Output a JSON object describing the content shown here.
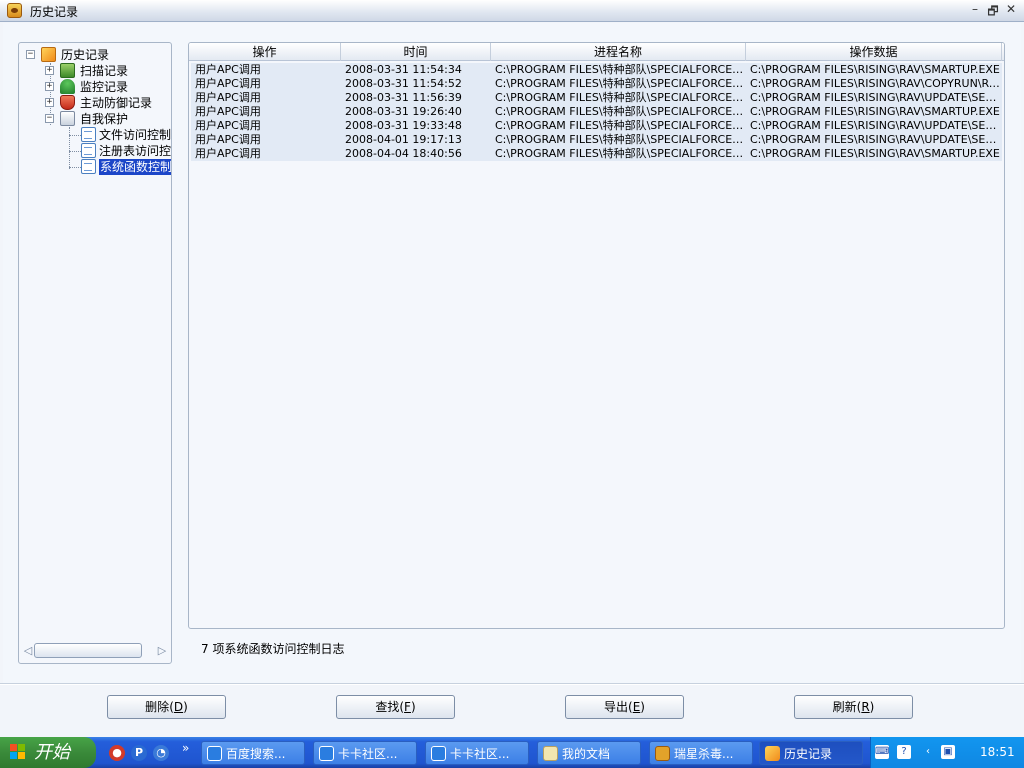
{
  "window": {
    "title": "历史记录",
    "min": "–",
    "restore": "🗗",
    "close": "✕"
  },
  "tree": {
    "root": "历史记录",
    "items": [
      {
        "label": "扫描记录"
      },
      {
        "label": "监控记录"
      },
      {
        "label": "主动防御记录"
      },
      {
        "label": "自我保护"
      }
    ],
    "children": [
      {
        "label": "文件访问控制"
      },
      {
        "label": "注册表访问控制"
      },
      {
        "label": "系统函数控制"
      }
    ],
    "scroll_left": "◁",
    "scroll_right": "▷"
  },
  "table": {
    "columns": [
      "操作",
      "时间",
      "进程名称",
      "操作数据"
    ],
    "rows": [
      [
        "用户APC调用",
        "2008-03-31 11:54:34",
        "C:\\PROGRAM FILES\\特种部队\\SPECIALFORCE\\G...",
        "C:\\PROGRAM FILES\\RISING\\RAV\\SMARTUP.EXE"
      ],
      [
        "用户APC调用",
        "2008-03-31 11:54:52",
        "C:\\PROGRAM FILES\\特种部队\\SPECIALFORCE\\G...",
        "C:\\PROGRAM FILES\\RISING\\RAV\\COPYRUN\\RAV..."
      ],
      [
        "用户APC调用",
        "2008-03-31 11:56:39",
        "C:\\PROGRAM FILES\\特种部队\\SPECIALFORCE\\G...",
        "C:\\PROGRAM FILES\\RISING\\RAV\\UPDATE\\SETUP..."
      ],
      [
        "用户APC调用",
        "2008-03-31 19:26:40",
        "C:\\PROGRAM FILES\\特种部队\\SPECIALFORCE\\G...",
        "C:\\PROGRAM FILES\\RISING\\RAV\\SMARTUP.EXE"
      ],
      [
        "用户APC调用",
        "2008-03-31 19:33:48",
        "C:\\PROGRAM FILES\\特种部队\\SPECIALFORCE\\G...",
        "C:\\PROGRAM FILES\\RISING\\RAV\\UPDATE\\SETUP..."
      ],
      [
        "用户APC调用",
        "2008-04-01 19:17:13",
        "C:\\PROGRAM FILES\\特种部队\\SPECIALFORCE\\G...",
        "C:\\PROGRAM FILES\\RISING\\RAV\\UPDATE\\SETUP..."
      ],
      [
        "用户APC调用",
        "2008-04-04 18:40:56",
        "C:\\PROGRAM FILES\\特种部队\\SPECIALFORCE\\G...",
        "C:\\PROGRAM FILES\\RISING\\RAV\\SMARTUP.EXE"
      ]
    ]
  },
  "status": "7 项系统函数访问控制日志",
  "buttons": [
    {
      "label": "删除",
      "key": "D"
    },
    {
      "label": "查找",
      "key": "F"
    },
    {
      "label": "导出",
      "key": "E"
    },
    {
      "label": "刷新",
      "key": "R"
    }
  ],
  "taskbar": {
    "start": "开始",
    "more": "»",
    "tasks": [
      {
        "label": "百度搜索..."
      },
      {
        "label": "卡卡社区..."
      },
      {
        "label": "卡卡社区..."
      },
      {
        "label": "我的文档"
      },
      {
        "label": "瑞星杀毒..."
      },
      {
        "label": "历史记录"
      }
    ],
    "tray_expand": "‹",
    "clock": "18:51"
  },
  "colors": {
    "selection": "#1c46c8",
    "row_bg": "#e2eaf5",
    "taskbar": "#245edb",
    "start_button": "#3a8a3a"
  }
}
